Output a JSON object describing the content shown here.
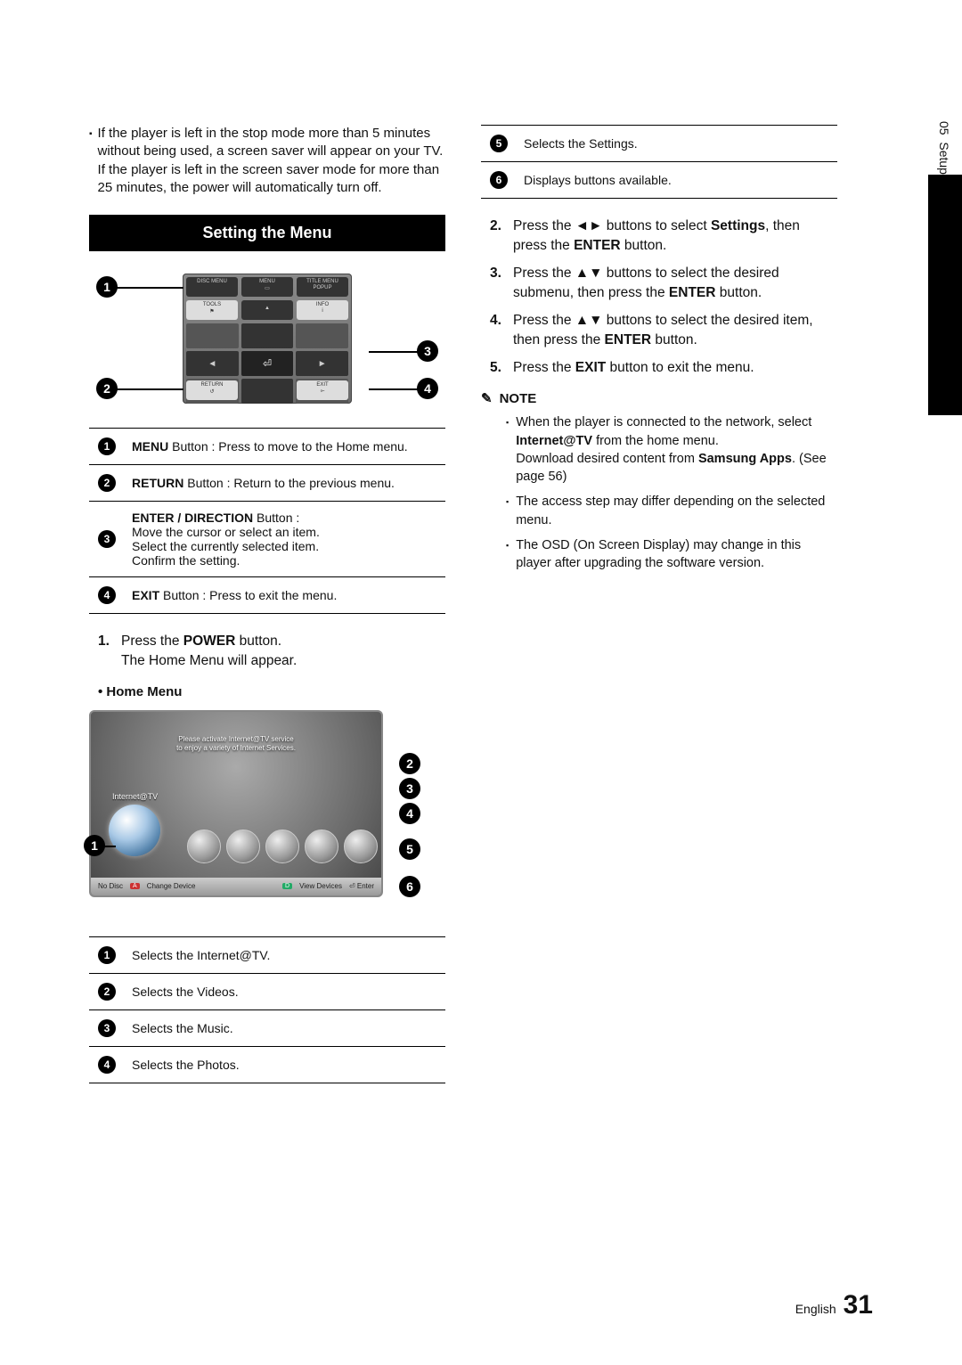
{
  "side_tab": {
    "chapter_num": "05",
    "chapter_title": "Setup"
  },
  "intro_note": "If the player is left in the stop mode more than 5 minutes without being used, a screen saver will appear on your TV. If the player is left in the screen saver mode for more than 25 minutes, the power will automatically turn off.",
  "section_title": "Setting the Menu",
  "remote": {
    "row1": [
      "DISC MENU",
      "MENU",
      "TITLE MENU"
    ],
    "row1_sub": [
      "",
      "▭",
      "POPUP"
    ],
    "row2": [
      "TOOLS",
      "",
      "INFO"
    ],
    "row2_icon": [
      "⚑",
      "▲",
      "i"
    ],
    "dpad": {
      "left": "◄",
      "center": "⏎",
      "right": "►"
    },
    "row4": [
      "RETURN",
      "",
      "EXIT"
    ],
    "row4_icon": [
      "↺",
      "▼",
      "⟜"
    ]
  },
  "remote_callouts": {
    "c1": "1",
    "c2": "2",
    "c3": "3",
    "c4": "4"
  },
  "remote_legend": [
    {
      "n": "1",
      "html": "<b>MENU</b> Button : Press to move to the Home menu."
    },
    {
      "n": "2",
      "html": "<b>RETURN</b> Button : Return to the previous menu."
    },
    {
      "n": "3",
      "html": "<b>ENTER / DIRECTION</b> Button :<br>Move the cursor or select an item.<br>Select the currently selected item.<br>Confirm the setting."
    },
    {
      "n": "4",
      "html": "<b>EXIT</b> Button : Press to exit the menu."
    }
  ],
  "step1": {
    "num": "1.",
    "html": "Press the <b>POWER</b> button.<br>The Home Menu will appear."
  },
  "home_menu_bullet": "• Home Menu",
  "tv": {
    "banner_l1": "Please activate Internet@TV service",
    "banner_l2": "to enjoy a variety of Internet Services.",
    "itv": "Internet@TV",
    "bar": {
      "nodisc": "No Disc",
      "a": "A",
      "a_label": "Change Device",
      "d": "D",
      "d_label": "View Devices",
      "enter": "⏎ Enter"
    }
  },
  "tv_callouts": [
    "1",
    "2",
    "3",
    "4",
    "5",
    "6"
  ],
  "home_legend": [
    {
      "n": "1",
      "text": "Selects the Internet@TV."
    },
    {
      "n": "2",
      "text": "Selects the Videos."
    },
    {
      "n": "3",
      "text": "Selects the Music."
    },
    {
      "n": "4",
      "text": "Selects the Photos."
    }
  ],
  "right_legend": [
    {
      "n": "5",
      "text": "Selects the Settings."
    },
    {
      "n": "6",
      "text": "Displays buttons available."
    }
  ],
  "steps_right": [
    {
      "num": "2.",
      "html": "Press the ◄► buttons to select <b>Settings</b>, then press the <b>ENTER</b> button."
    },
    {
      "num": "3.",
      "html": "Press the ▲▼ buttons to select the desired submenu, then press the <b>ENTER</b> button."
    },
    {
      "num": "4.",
      "html": "Press the ▲▼ buttons to select the desired item, then press the <b>ENTER</b> button."
    },
    {
      "num": "5.",
      "html": "Press the <b>EXIT</b> button to exit the menu."
    }
  ],
  "note_label": "NOTE",
  "notes": [
    "When the player is connected to the network, select <b>Internet@TV</b> from the home menu.<br>Download desired content from <b>Samsung Apps</b>. (See page 56)",
    "The access step may differ depending on the selected menu.",
    "The OSD (On Screen Display) may change in this player after upgrading the software version."
  ],
  "footer": {
    "lang": "English",
    "page": "31"
  }
}
